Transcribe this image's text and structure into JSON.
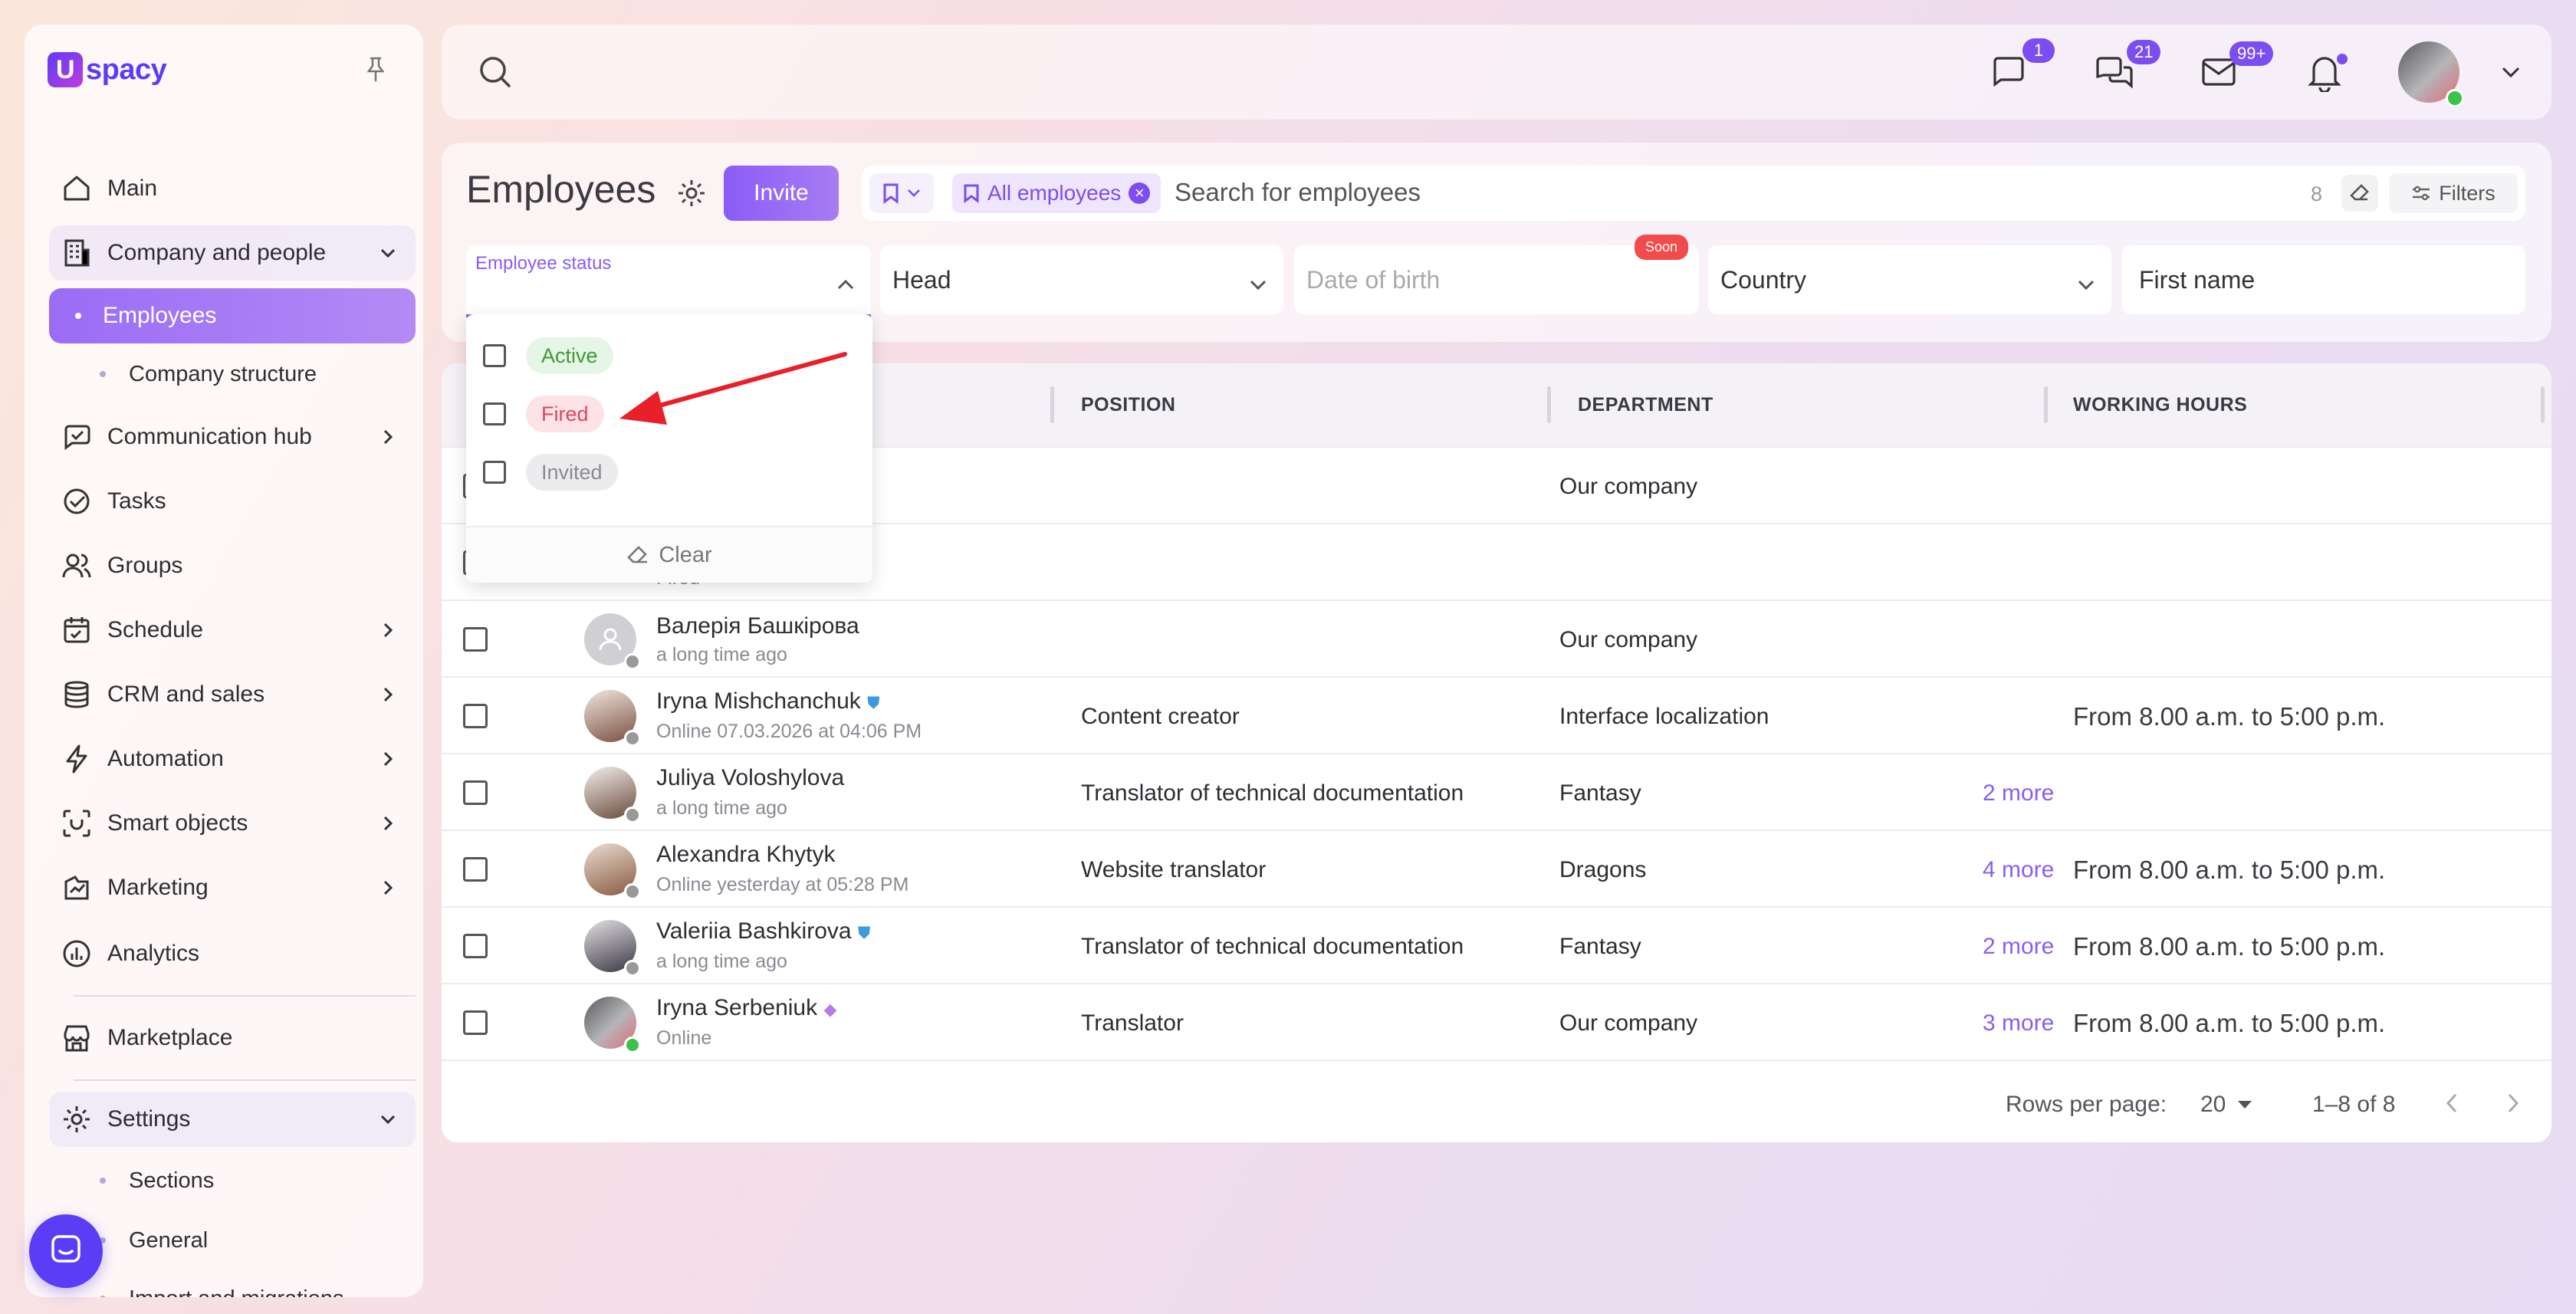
{
  "app": {
    "logo_text": "spacy",
    "logo_letter": "U"
  },
  "sidebar": {
    "items": [
      {
        "label": "Main",
        "icon": "home-icon"
      },
      {
        "label": "Company and people",
        "icon": "building-icon"
      },
      {
        "label": "Employees"
      },
      {
        "label": "Company structure"
      },
      {
        "label": "Communication hub",
        "icon": "chat-hub-icon"
      },
      {
        "label": "Tasks",
        "icon": "check-circle-icon"
      },
      {
        "label": "Groups",
        "icon": "users-icon"
      },
      {
        "label": "Schedule",
        "icon": "calendar-icon"
      },
      {
        "label": "CRM and sales",
        "icon": "database-icon"
      },
      {
        "label": "Automation",
        "icon": "lightning-icon"
      },
      {
        "label": "Smart objects",
        "icon": "scan-icon"
      },
      {
        "label": "Marketing",
        "icon": "marketing-icon"
      },
      {
        "label": "Analytics",
        "icon": "chart-icon"
      },
      {
        "label": "Marketplace",
        "icon": "store-icon"
      },
      {
        "label": "Settings",
        "icon": "gear-icon"
      },
      {
        "label": "Sections"
      },
      {
        "label": "General"
      },
      {
        "label": "Import and migrations"
      }
    ]
  },
  "topbar": {
    "badges": {
      "chat": "1",
      "messages": "21",
      "mail": "99+"
    }
  },
  "page": {
    "title": "Employees",
    "invite_label": "Invite",
    "chip_label": "All employees",
    "search_placeholder": "Search for employees",
    "count": "8",
    "filters_label": "Filters"
  },
  "filters": {
    "employee_status": "Employee status",
    "head": "Head",
    "date_of_birth": "Date of birth",
    "soon": "Soon",
    "country": "Country",
    "first_name": "First name"
  },
  "dropdown": {
    "options": [
      "Active",
      "Fired",
      "Invited"
    ],
    "clear_label": "Clear"
  },
  "table": {
    "headers": [
      "POSITION",
      "DEPARTMENT",
      "WORKING HOURS"
    ],
    "rows": [
      {
        "name": "",
        "sub": "",
        "position": "",
        "department": "Our company",
        "more": "",
        "hours": ""
      },
      {
        "name": "",
        "sub": "Fired",
        "position": "",
        "department": "",
        "more": "",
        "hours": ""
      },
      {
        "name": "Валерія Башкірова",
        "sub": "a long time ago",
        "position": "",
        "department": "Our company",
        "more": "",
        "hours": ""
      },
      {
        "name": "Iryna Mishchanchuk",
        "sub": "Online 07.03.2026 at 04:06 PM",
        "position": "Content creator",
        "department": "Interface localization",
        "more": "",
        "hours": "From 8.00 a.m. to 5:00 p.m."
      },
      {
        "name": "Juliya Voloshylova",
        "sub": "a long time ago",
        "position": "Translator of technical documentation",
        "department": "Fantasy",
        "more": "2 more",
        "hours": ""
      },
      {
        "name": "Alexandra Khytyk",
        "sub": "Online yesterday at 05:28 PM",
        "position": "Website translator",
        "department": "Dragons",
        "more": "4 more",
        "hours": "From 8.00 a.m. to 5:00 p.m."
      },
      {
        "name": "Valeriia Bashkirova",
        "sub": "a long time ago",
        "position": "Translator of technical documentation",
        "department": "Fantasy",
        "more": "2 more",
        "hours": "From 8.00 a.m. to 5:00 p.m."
      },
      {
        "name": "Iryna Serbeniuk",
        "sub": "Online",
        "position": "Translator",
        "department": "Our company",
        "more": "3 more",
        "hours": "From 8.00 a.m. to 5:00 p.m."
      }
    ],
    "footer": {
      "rows_per_page_label": "Rows per page:",
      "rows_per_page_value": "20",
      "range": "1–8 of 8"
    }
  },
  "colors": {
    "accent": "#8b5cf6",
    "active_tag_bg": "#e6f6e6",
    "fired_tag_bg": "#fde2e6",
    "invited_tag_bg": "#ececef"
  }
}
